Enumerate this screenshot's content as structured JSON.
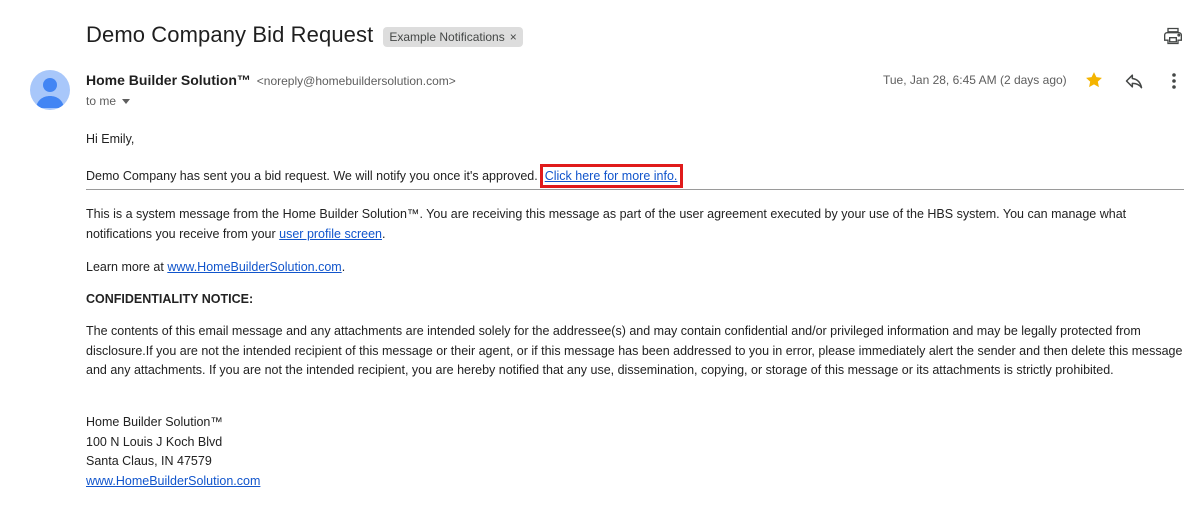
{
  "email": {
    "subject": "Demo Company Bid Request",
    "label": "Example Notifications",
    "label_remove": "×",
    "sender_name": "Home Builder Solution™",
    "sender_email": "<noreply@homebuildersolution.com>",
    "recipient": "to me",
    "date": "Tue, Jan 28, 6:45 AM (2 days ago)"
  },
  "body": {
    "greeting": "Hi Emily,",
    "message": "Demo Company has sent you a bid request. We will notify you once it's approved.",
    "info_link": "Click here for more info.",
    "system_text": "This is a system message from the Home Builder Solution™. You are receiving this message as part of the user agreement executed by your use of the HBS system. You can manage what notifications you receive from your",
    "profile_link": "user profile screen",
    "system_end": ".",
    "learn_more": "Learn more at",
    "learn_link": "www.HomeBuilderSolution.com",
    "learn_end": ".",
    "confidentiality_title": "CONFIDENTIALITY NOTICE:",
    "confidentiality_text": "The contents of this email message and any attachments are intended solely for the addressee(s) and may contain confidential and/or privileged information and may be legally protected from disclosure.If you are not the intended recipient of this message or their agent, or if this message has been addressed to you in error, please immediately alert the sender and then delete this message and any attachments. If you are not the intended recipient, you are hereby notified that any use, dissemination, copying, or storage of this message or its attachments is strictly prohibited."
  },
  "signature": {
    "company": "Home Builder Solution™",
    "street": "100 N Louis J Koch Blvd",
    "city": "Santa Claus, IN 47579",
    "website": "www.HomeBuilderSolution.com"
  },
  "icons": {
    "print": "printer-icon",
    "star": "star-icon",
    "reply": "reply-icon",
    "more": "more-vert-icon",
    "avatar": "person-icon"
  },
  "colors": {
    "link": "#1155cc",
    "star": "#f4b400",
    "highlight_box": "#e01b1b",
    "avatar_bg": "#a8c7fa",
    "avatar_fg": "#4285f4"
  }
}
